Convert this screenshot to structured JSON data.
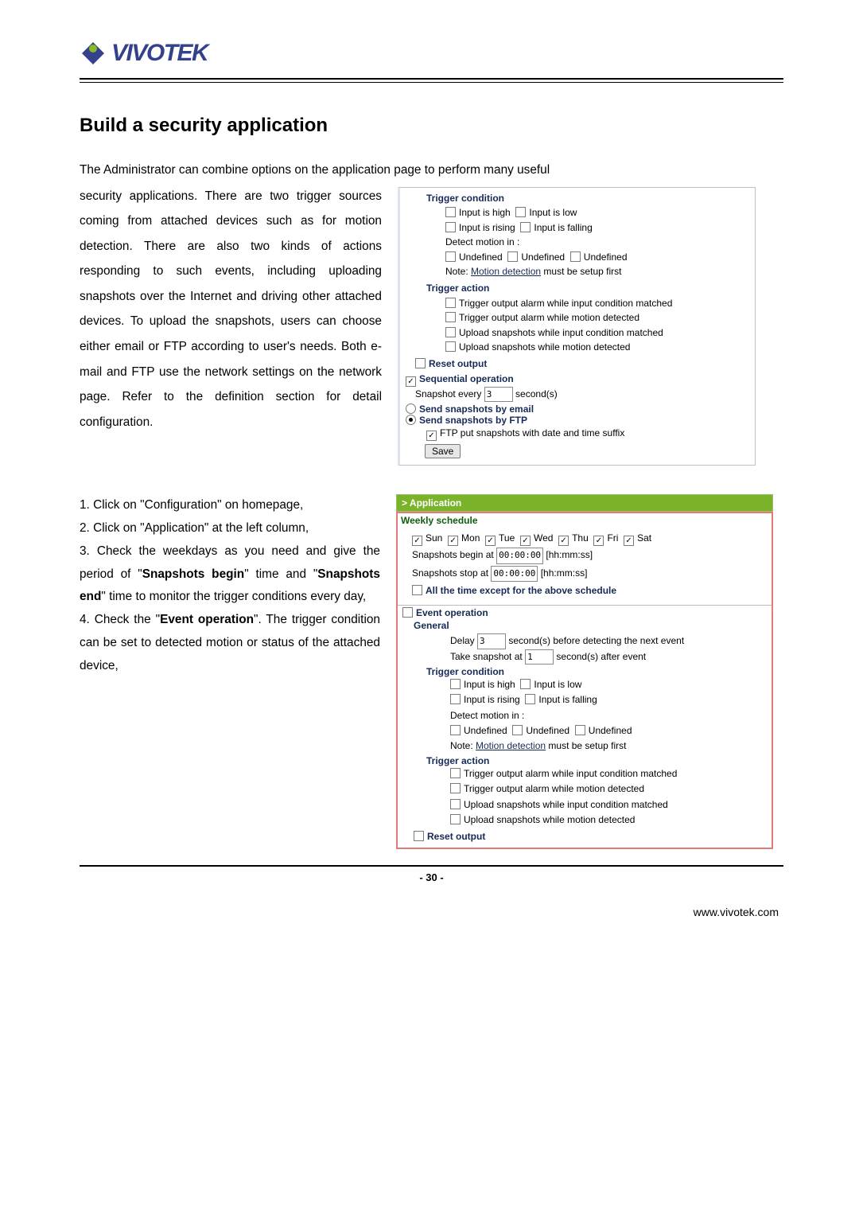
{
  "logo": {
    "text": "VIVOTEK"
  },
  "heading": "Build a security application",
  "intro": "The Administrator can combine options on the application page to perform many useful",
  "body1": "security applications. There are two trigger sources coming from attached devices such as for motion detection. There are also two kinds of actions responding to such events, including uploading snapshots over the Internet and driving other attached devices. To upload the snapshots, users can choose either email or FTP according to user's needs. Both e-mail and FTP use the network settings on the network page. Refer to the definition section for detail configuration.",
  "steps": {
    "s1": "1. Click on \"Configuration\" on homepage,",
    "s2a": "2. Click on \"Application\" at the left column,",
    "s3a": "3. Check the weekdays as you need and give the period of \"",
    "s3b": "Snapshots begin",
    "s3c": "\" time and \"",
    "s3d": "Snapshots end",
    "s3e": "\" time to monitor the trigger conditions every day,",
    "s4a": "4. Check the \"",
    "s4b": "Event operation",
    "s4c": "\". The trigger condition can be set to detected motion or status of the attached device,"
  },
  "ss1": {
    "trigger_condition": "Trigger condition",
    "input_high": "Input is high",
    "input_low": "Input is low",
    "input_rising": "Input is rising",
    "input_falling": "Input is falling",
    "detect_motion": "Detect motion in :",
    "undef": "Undefined",
    "note": "Note: ",
    "motion_detection": "Motion detection",
    "note_tail": " must be setup first",
    "trigger_action": "Trigger action",
    "ta1": "Trigger output alarm while input condition matched",
    "ta2": "Trigger output alarm while motion detected",
    "ta3": "Upload snapshots while input condition matched",
    "ta4": "Upload snapshots while motion detected",
    "reset_output": "Reset output",
    "seq": "Sequential operation",
    "snapshot_every_a": "Snapshot every ",
    "snapshot_every_val": "3",
    "snapshot_every_b": " second(s)",
    "send_email": "Send snapshots by email",
    "send_ftp": "Send snapshots by FTP",
    "ftp_suffix": "FTP put snapshots with date and time suffix",
    "save": "Save"
  },
  "ss2": {
    "app": "> Application",
    "weekly_schedule": "Weekly schedule",
    "days": {
      "sun": "Sun",
      "mon": "Mon",
      "tue": "Tue",
      "wed": "Wed",
      "thu": "Thu",
      "fri": "Fri",
      "sat": "Sat"
    },
    "snap_begin_a": "Snapshots begin at ",
    "snap_begin_val": "00:00:00",
    "snap_begin_b": " [hh:mm:ss]",
    "snap_stop_a": "Snapshots stop at ",
    "snap_stop_val": "00:00:00",
    "snap_stop_b": " [hh:mm:ss]",
    "all_time": "All the time except for the above schedule",
    "event_op": "Event operation",
    "general": "General",
    "delay_a": "Delay ",
    "delay_val": "3",
    "delay_b": " second(s) before detecting the next event",
    "take_a": "Take snapshot at ",
    "take_val": "1",
    "take_b": " second(s) after event",
    "trigger_condition": "Trigger condition",
    "input_high": "Input is high",
    "input_low": "Input is low",
    "input_rising": "Input is rising",
    "input_falling": "Input is falling",
    "detect_motion": "Detect motion in :",
    "undef": "Undefined",
    "note": "Note: ",
    "motion_detection": "Motion detection",
    "note_tail": " must be setup first",
    "trigger_action": "Trigger action",
    "ta1": "Trigger output alarm while input condition matched",
    "ta2": "Trigger output alarm while motion detected",
    "ta3": "Upload snapshots while input condition matched",
    "ta4": "Upload snapshots while motion detected",
    "reset_output": "Reset output"
  },
  "page_num": "- 30 -",
  "footer_url": "www.vivotek.com"
}
